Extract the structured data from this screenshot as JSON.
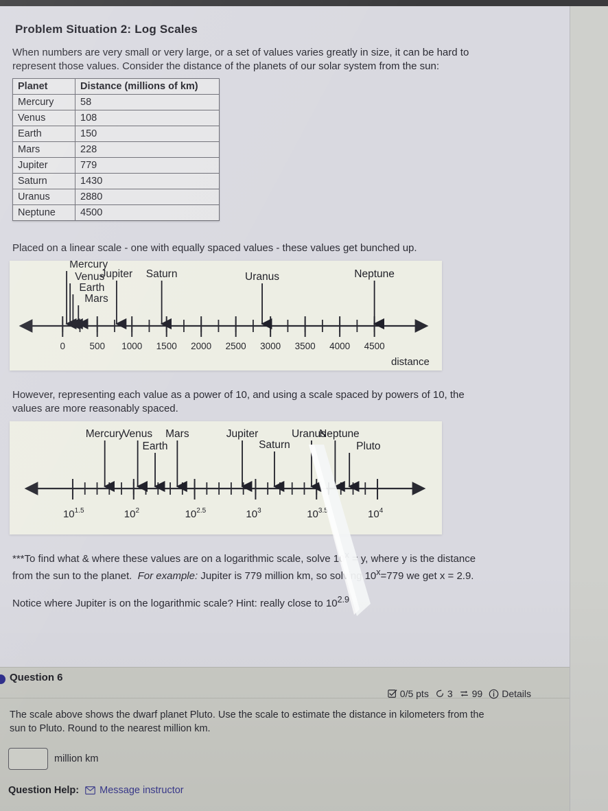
{
  "page": {
    "title": "Problem Situation 2: Log Scales",
    "intro": "When numbers are very small or very large, or a set of values varies greatly in size, it can be hard to represent those values.  Consider the distance of the planets of our solar system from the sun:",
    "linear_caption": "Placed on a linear scale - one with equally spaced values - these values get bunched up.",
    "log_caption": "However, representing each value as a power of 10, and using a scale spaced by powers of 10, the values are more reasonably spaced.",
    "note_1_prefix": "***To find what & where these values are on a logarithmic scale, solve 10",
    "note_1": "***To find what & where these values are on a logarithmic scale, solve 10x = y, where y is the distance from the sun to the planet.  For example: Jupiter is 779 million km, so solving 10x=779 we get x = 2.9.",
    "note_2": "Notice where Jupiter is on the logarithmic scale? Hint: really close to 102.9"
  },
  "table": {
    "headers": [
      "Planet",
      "Distance (millions of km)"
    ],
    "rows": [
      [
        "Mercury",
        "58"
      ],
      [
        "Venus",
        "108"
      ],
      [
        "Earth",
        "150"
      ],
      [
        "Mars",
        "228"
      ],
      [
        "Jupiter",
        "779"
      ],
      [
        "Saturn",
        "1430"
      ],
      [
        "Uranus",
        "2880"
      ],
      [
        "Neptune",
        "4500"
      ]
    ]
  },
  "chart_data": [
    {
      "type": "scatter",
      "name": "linear-number-line",
      "title": "",
      "xlabel": "distance",
      "xlim": [
        -250,
        4900
      ],
      "x_ticks": [
        0,
        500,
        1000,
        1500,
        2000,
        2500,
        3000,
        3500,
        4000,
        4500
      ],
      "x_tick_labels": [
        "0",
        "500",
        "1000",
        "1500",
        "2000",
        "2500",
        "3000",
        "3500",
        "4000",
        "4500"
      ],
      "minor_tick_step": 250,
      "grid": false,
      "annotations": [
        {
          "label": "Mercury",
          "value": 58
        },
        {
          "label": "Venus",
          "value": 108
        },
        {
          "label": "Earth",
          "value": 150
        },
        {
          "label": "Mars",
          "value": 228
        },
        {
          "label": "Jupiter",
          "value": 779
        },
        {
          "label": "Saturn",
          "value": 1430
        },
        {
          "label": "Uranus",
          "value": 2880
        },
        {
          "label": "Neptune",
          "value": 4500
        }
      ]
    },
    {
      "type": "scatter",
      "name": "logarithmic-number-line",
      "title": "",
      "xlabel": "",
      "xlim": [
        1.32,
        4.18
      ],
      "x_ticks": [
        1.5,
        2.0,
        2.5,
        3.0,
        3.5,
        4.0
      ],
      "x_tick_labels": [
        "10^1.5",
        "10^2",
        "10^2.5",
        "10^3",
        "10^3.5",
        "10^4"
      ],
      "minor_tick_step": 0.1,
      "grid": false,
      "annotations": [
        {
          "label": "Mercury",
          "value": 1.763
        },
        {
          "label": "Venus",
          "value": 2.033
        },
        {
          "label": "Earth",
          "value": 2.176
        },
        {
          "label": "Mars",
          "value": 2.358
        },
        {
          "label": "Jupiter",
          "value": 2.891
        },
        {
          "label": "Saturn",
          "value": 3.155
        },
        {
          "label": "Uranus",
          "value": 3.459
        },
        {
          "label": "Neptune",
          "value": 3.653
        },
        {
          "label": "Pluto",
          "value": 3.77
        }
      ]
    }
  ],
  "question": {
    "number_label": "Question 6",
    "points": "0/5 pts",
    "attempts": "3",
    "shuffle": "99",
    "details_label": "Details",
    "prompt": "The scale above shows the dwarf planet Pluto.  Use the scale to estimate the distance in kilometers from the sun to Pluto.  Round to the nearest million km.",
    "answer_value": "",
    "answer_placeholder": "",
    "answer_unit": "million km",
    "help_label": "Question Help:",
    "help_link": "Message instructor"
  }
}
